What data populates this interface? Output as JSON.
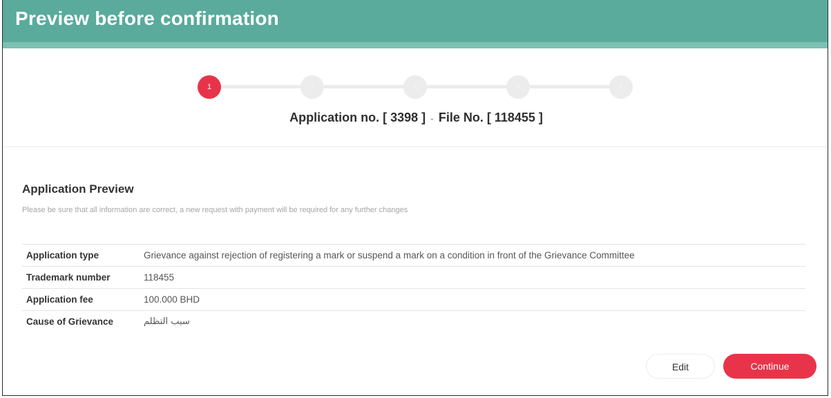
{
  "header": {
    "title": "Preview before confirmation"
  },
  "stepper": {
    "steps": [
      "1",
      "2",
      "3",
      "4",
      "5"
    ],
    "active_step": 1
  },
  "application_line": {
    "prefix": "Application no. [ 3398 ]",
    "separator": "-",
    "suffix": "File No. [ 118455 ]"
  },
  "preview": {
    "title": "Application Preview",
    "note": "Please be sure that all information are correct, a new request with payment will be required for any further changes",
    "rows": [
      {
        "label": "Application type",
        "value": "Grievance against rejection of registering a mark or suspend a mark on a condition in front of the Grievance Committee"
      },
      {
        "label": "Trademark number",
        "value": "118455"
      },
      {
        "label": "Application fee",
        "value": "100.000 BHD"
      },
      {
        "label": "Cause of Grievance",
        "value": "سبب التظلم"
      }
    ]
  },
  "buttons": {
    "edit_label": "Edit",
    "continue_label": "Continue"
  },
  "colors": {
    "header": "#5aab9c",
    "header_strip": "#7cc0b3",
    "accent": "#e8344a",
    "step_inactive": "#ececec"
  }
}
